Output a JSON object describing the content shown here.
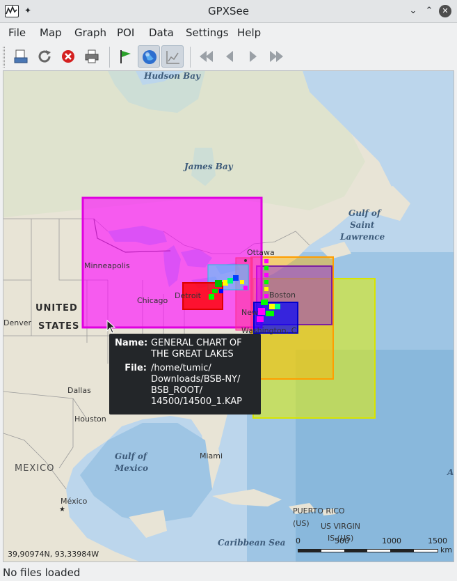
{
  "window": {
    "title": "GPXSee"
  },
  "menu": {
    "items": [
      "File",
      "Map",
      "Graph",
      "POI",
      "Data",
      "Settings",
      "Help"
    ]
  },
  "toolbar": {
    "buttons": [
      "open-file-icon",
      "reload-icon",
      "close-file-icon",
      "print-icon",
      "show-poi-icon",
      "show-map-icon",
      "show-graphs-icon",
      "first-file-icon",
      "previous-file-icon",
      "next-file-icon",
      "last-file-icon"
    ]
  },
  "map": {
    "labels": {
      "hudson_bay": "Hudson Bay",
      "james_bay": "James Bay",
      "gulf_st_lawrence_1": "Gulf of",
      "gulf_st_lawrence_2": "Saint",
      "gulf_st_lawrence_3": "Lawrence",
      "ottawa": "Ottawa",
      "minneapolis": "Minneapolis",
      "chicago": "Chicago",
      "detroit": "Detroit",
      "boston": "Boston",
      "new_york": "New",
      "washington": "Washington, C.",
      "united": "UNITED",
      "states": "STATES",
      "denver": "Denver",
      "dallas": "Dallas",
      "houston": "Houston",
      "gulf_mexico_1": "Gulf of",
      "gulf_mexico_2": "Mexico",
      "miami": "Miami",
      "mexico": "MEXICO",
      "mexico_city": "México",
      "puerto_rico_1": "PUERTO RICO",
      "puerto_rico_2": "(US)",
      "virgin_1": "US VIRGIN",
      "virgin_2": "IS (US)",
      "caribbean": "Caribbean Sea",
      "atlantic_a": "A"
    },
    "coordinates": "39,90974N, 93,33984W",
    "scale": {
      "ticks": [
        "0",
        "500",
        "1000",
        "1500"
      ],
      "unit": "km"
    }
  },
  "tooltip": {
    "name_key": "Name:",
    "name_value": "GENERAL CHART OF THE GREAT LAKES",
    "file_key": "File:",
    "file_value": "/home/tumic/ Downloads/BSB-NY/ BSB_ROOT/ 14500/14500_1.KAP"
  },
  "status": {
    "text": "No files loaded"
  },
  "colors": {
    "magenta_chart": "#ff00ff",
    "yellow_chart": "#e6f000",
    "orange_chart": "#ffb400",
    "purple_chart": "#8a2be2",
    "blue_chart": "#0000ff",
    "red_chart": "#ff0000",
    "cyan_chart": "#40e0ff",
    "tooltip_bg": "#232629"
  }
}
